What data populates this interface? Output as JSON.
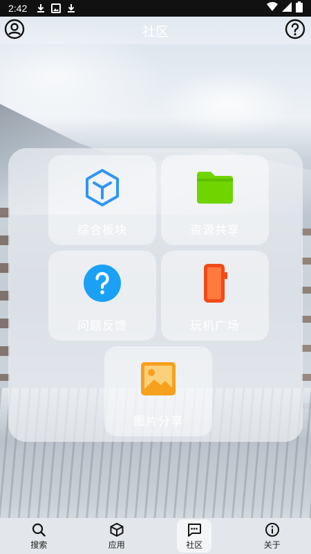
{
  "status_bar": {
    "time": "2:42",
    "icons": [
      "download-icon",
      "image-icon",
      "download-icon",
      "wifi-icon",
      "signal-icon",
      "battery-icon"
    ]
  },
  "app_bar": {
    "title": "社区",
    "left_icon": "account-circle-icon",
    "right_icon": "help-circle-icon"
  },
  "tiles": [
    {
      "label": "综合板块",
      "icon": "cube-icon",
      "color": "#2f95f5"
    },
    {
      "label": "资源共享",
      "icon": "folder-icon",
      "color": "#6fd400"
    },
    {
      "label": "问题反馈",
      "icon": "question-icon",
      "color": "#1aa1f5"
    },
    {
      "label": "玩机广场",
      "icon": "phone-icon",
      "color": "#f24a1a"
    },
    {
      "label": "图片分享",
      "icon": "image-icon",
      "color": "#f6a01d"
    }
  ],
  "bottom_nav": {
    "items": [
      {
        "label": "搜索",
        "icon": "search-icon"
      },
      {
        "label": "应用",
        "icon": "box-icon"
      },
      {
        "label": "社区",
        "icon": "chat-icon",
        "active": true
      },
      {
        "label": "关于",
        "icon": "info-icon"
      }
    ]
  }
}
